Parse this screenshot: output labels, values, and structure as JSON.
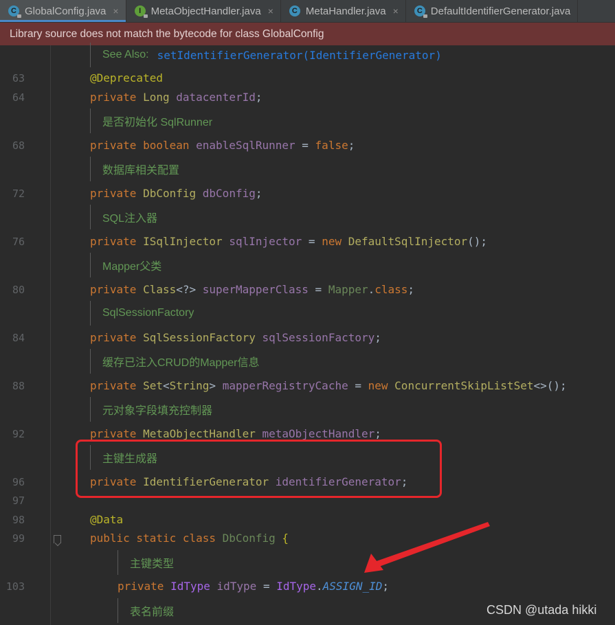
{
  "tabs": [
    {
      "name": "GlobalConfig.java",
      "icon": "class-file-icon",
      "active": true
    },
    {
      "name": "MetaObjectHandler.java",
      "icon": "interface-file-icon",
      "active": false
    },
    {
      "name": "MetaHandler.java",
      "icon": "class-file-icon",
      "active": false
    },
    {
      "name": "DefaultIdentifierGenerator.java",
      "icon": "class-file-icon",
      "active": false
    }
  ],
  "tab_icon_letters": {
    "class": "C",
    "interface": "I"
  },
  "close_glyph": "×",
  "banner": {
    "text": "Library source does not match the bytecode for class GlobalConfig"
  },
  "editor": {
    "see_also_label": "See Also:",
    "see_also_link": "setIdentifierGenerator(IdentifierGenerator)",
    "line_numbers": {
      "l63": "63",
      "l64": "64",
      "l68": "68",
      "l72": "72",
      "l76": "76",
      "l80": "80",
      "l84": "84",
      "l88": "88",
      "l92": "92",
      "l96": "96",
      "l97": "97",
      "l98": "98",
      "l99": "99",
      "l103": "103"
    },
    "docs": {
      "sqlrunner": "是否初始化 SqlRunner",
      "db": "数据库相关配置",
      "injector": "SQL注入器",
      "mapper": "Mapper父类",
      "sessionfactory": "SqlSessionFactory",
      "cache": "缓存已注入CRUD的Mapper信息",
      "metaobj": "元对象字段填充控制器",
      "idgen": "主键生成器",
      "idtype": "主键类型",
      "tableprefix": "表名前缀"
    }
  },
  "watermark": "CSDN @utada hikki",
  "colors": {
    "highlight_box": "#e5262b",
    "arrow": "#e5262b",
    "banner_bg": "#6b3434",
    "editor_bg": "#2b2b2b"
  }
}
